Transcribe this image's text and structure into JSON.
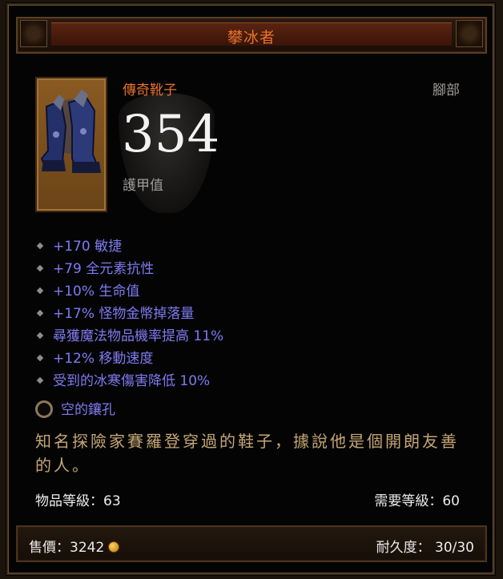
{
  "item": {
    "name": "攀冰者",
    "quality_type": "傳奇靴子",
    "slot": "腳部",
    "armor_value": "354",
    "armor_label": "護甲值"
  },
  "affixes": [
    "+170 敏捷",
    "+79 全元素抗性",
    "+10% 生命值",
    "+17% 怪物金幣掉落量",
    "尋獲魔法物品機率提高 11%",
    "+12% 移動速度",
    "受到的冰寒傷害降低 10%"
  ],
  "socket": {
    "label": "空的鑲孔"
  },
  "flavor": "知名探險家賽羅登穿過的鞋子，據說他是個開朗友善的人。",
  "levels": {
    "item_level_label": "物品等級：63",
    "required_level_label": "需要等級：60"
  },
  "footer": {
    "price_label": "售價：",
    "price_value": "3242",
    "durability_label": "耐久度：",
    "durability_value": "30/30"
  },
  "colors": {
    "title": "#e8722b",
    "magic_affix": "#7d7bf1",
    "flavor_text": "#c4a775",
    "white_text": "#ececec",
    "gray_text": "#9e9d9a"
  },
  "icons": {
    "affix_bullet": "diamond-bullet-icon",
    "socket": "empty-socket-icon",
    "currency": "gold-coin-icon",
    "item_art": "boots-icon"
  }
}
